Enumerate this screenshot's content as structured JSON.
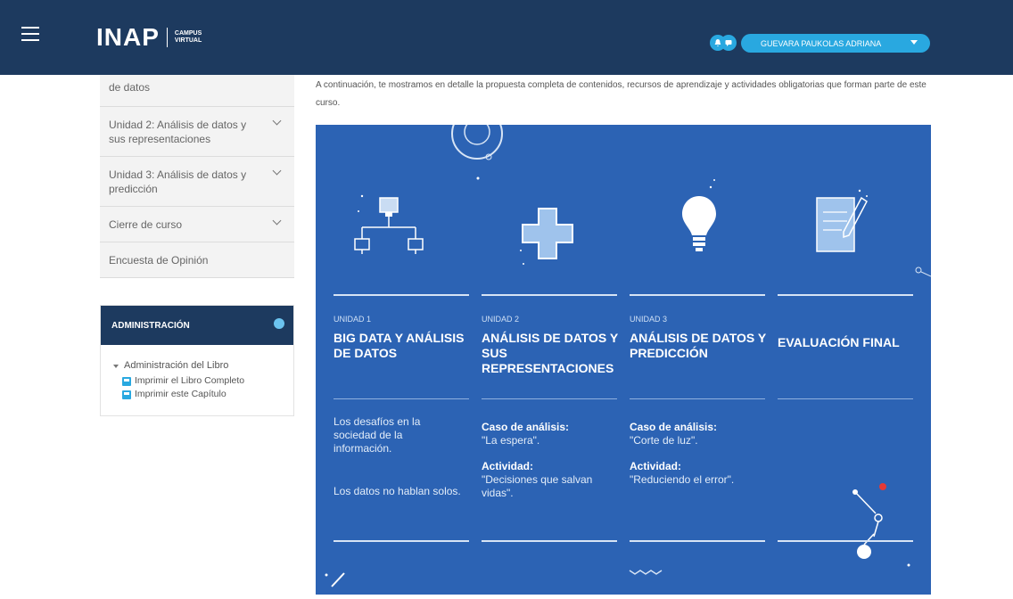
{
  "header": {
    "menu_icon": "hamburger-icon",
    "logo": "INAP",
    "logo_sub": "CAMPUS VIRTUAL",
    "bell_icon": "bell-icon",
    "message_icon": "message-icon",
    "user_name": "GUEVARA PAUKOLAS ADRIANA"
  },
  "sidebar": {
    "items": [
      {
        "label": "de datos"
      },
      {
        "label": "Unidad 2: Análisis de datos y sus representaciones"
      },
      {
        "label": "Unidad 3: Análisis de datos y predicción"
      },
      {
        "label": "Cierre de curso"
      },
      {
        "label": "Encuesta de Opinión"
      }
    ]
  },
  "admin": {
    "title": "ADMINISTRACIÓN",
    "group": "Administración del Libro",
    "links": [
      "Imprimir el Libro Completo",
      "Imprimir este Capítulo"
    ]
  },
  "intro": "A continuación, te mostramos en detalle la propuesta completa de contenidos, recursos de aprendizaje y actividades obligatorias que forman parte de este curso.",
  "units": [
    {
      "label": "UNIDAD 1",
      "title": "BIG DATA Y ANÁLISIS DE DATOS",
      "icon": "network-diagram-icon",
      "p1": "Los desafíos en la sociedad de la información.",
      "p2": "Los datos no hablan solos."
    },
    {
      "label": "UNIDAD 2",
      "title": "ANÁLISIS DE DATOS Y SUS REPRESENTACIONES",
      "icon": "plus-icon",
      "p1_bold": "Caso de análisis:",
      "p1": "\"La espera\".",
      "p2_bold": "Actividad:",
      "p2": "\"Decisiones que salvan vidas\"."
    },
    {
      "label": "UNIDAD 3",
      "title": "ANÁLISIS DE DATOS Y PREDICCIÓN",
      "icon": "lightbulb-icon",
      "p1_bold": "Caso de análisis:",
      "p1": "\"Corte de luz\".",
      "p2_bold": "Actividad:",
      "p2": "\"Reduciendo el error\"."
    },
    {
      "label": "",
      "title": "EVALUACIÓN FINAL",
      "icon": "document-pencil-icon"
    }
  ]
}
